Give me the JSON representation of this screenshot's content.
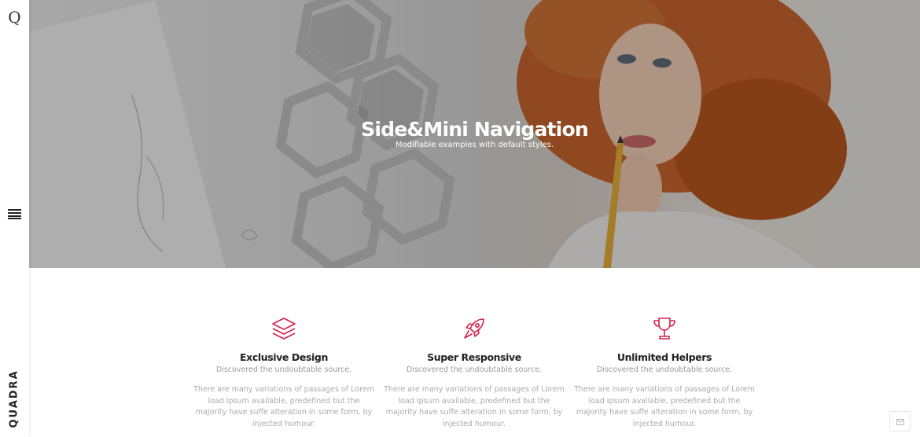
{
  "sidebar": {
    "logo_letter": "Q",
    "brand": "QUADRA",
    "menu_icon": "hamburger-menu-icon"
  },
  "hero": {
    "title": "Side&Mini Navigation",
    "subtitle": "Modifiable examples with default styles."
  },
  "features": [
    {
      "icon": "layers-icon",
      "title": "Exclusive Design",
      "subtitle": "Discovered the undoubtable source.",
      "body": "There are many variations of passages of Lorem load Ipsum available, predefined but the majority have suffe alteration in some form, by injected humour."
    },
    {
      "icon": "rocket-icon",
      "title": "Super Responsive",
      "subtitle": "Discovered the undoubtable source.",
      "body": "There are many variations of passages of Lorem load Ipsum available, predefined but the majority have suffe alteration in some form, by injected humour."
    },
    {
      "icon": "trophy-icon",
      "title": "Unlimited Helpers",
      "subtitle": "Discovered the undoubtable source.",
      "body": "There are many variations of passages of Lorem load Ipsum available, predefined but the majority have suffe alteration in some form, by injected humour."
    }
  ],
  "contact_button": {
    "icon": "envelope-icon"
  },
  "colors": {
    "accent": "#d4224a",
    "hair": "#c8642e",
    "pencil": "#e2ae3a"
  }
}
